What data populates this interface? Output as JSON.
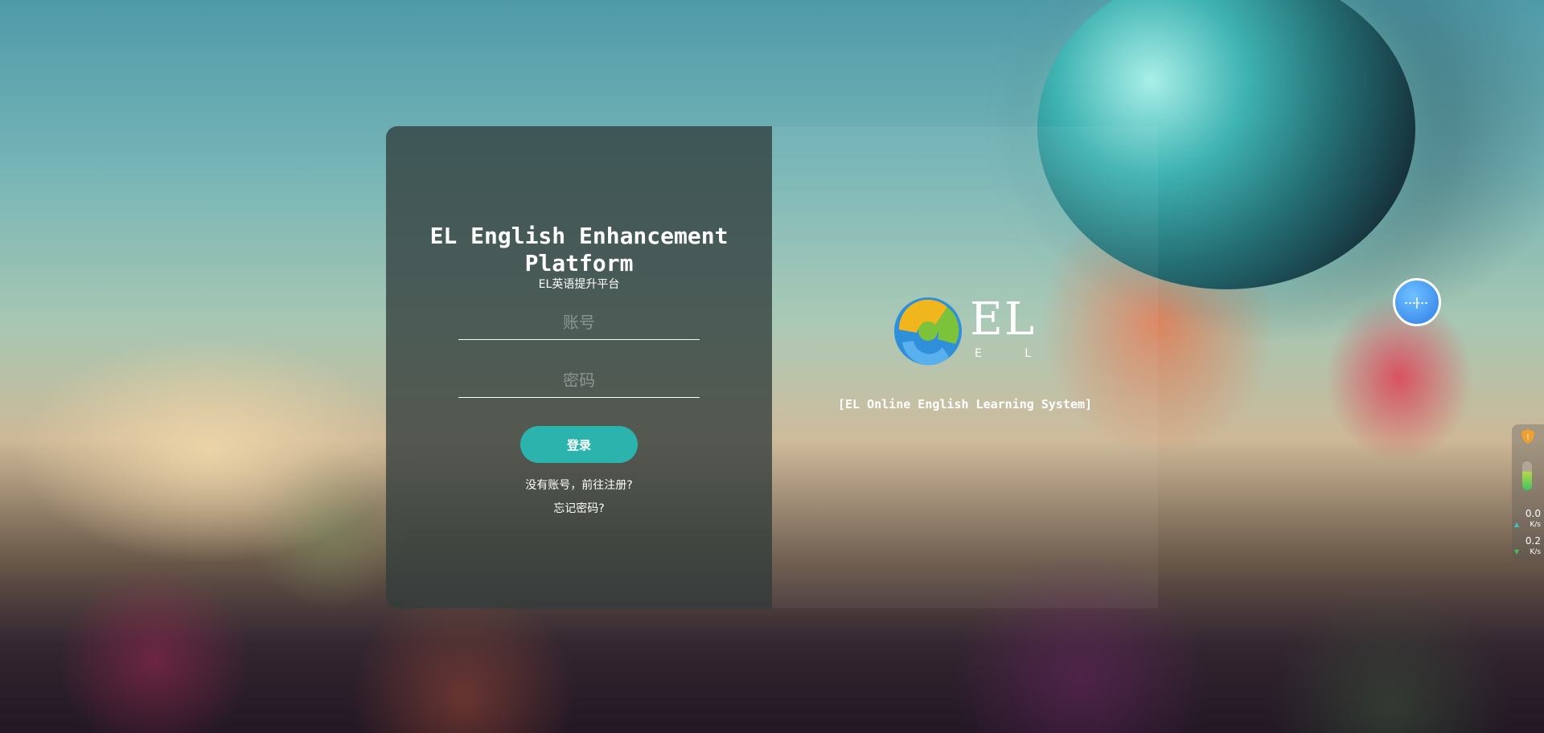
{
  "login": {
    "title": "EL English Enhancement Platform",
    "subtitle": "EL英语提升平台",
    "username_placeholder": "账号",
    "password_placeholder": "密码",
    "login_button": "登录",
    "register_link": "没有账号，前往注册?",
    "forgot_link": "忘记密码?"
  },
  "brand": {
    "logo_text": "EL",
    "logo_sub_letters": [
      "E",
      "L"
    ],
    "tagline": "[EL Online English Learning System]"
  },
  "net_widget": {
    "upload_value": "0.0",
    "upload_unit": "K/s",
    "download_value": "0.2",
    "download_unit": "K/s",
    "upload_arrow_color": "#3ec4c0",
    "download_arrow_color": "#3ec45e"
  },
  "colors": {
    "accent": "#2bb3ad",
    "card_bg": "rgba(50,62,60,0.78)"
  }
}
